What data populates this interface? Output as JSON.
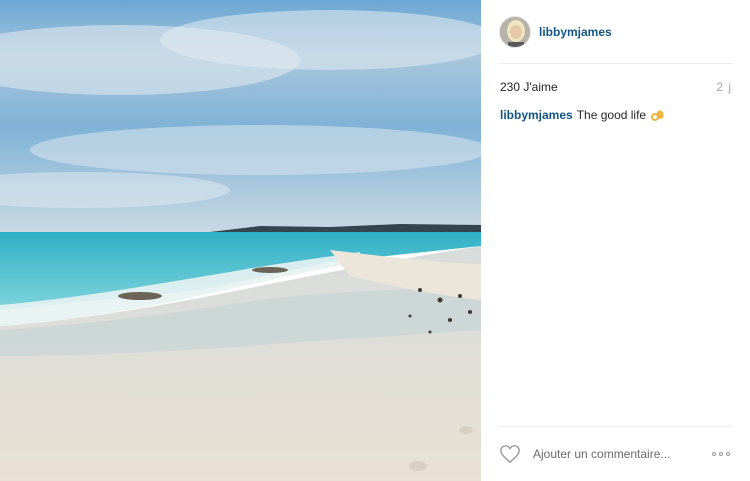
{
  "post": {
    "username": "libbymjames",
    "likes": "230 J'aime",
    "time": "2 j",
    "caption_user": "libbymjames",
    "caption_text": "The good life",
    "caption_emoji": "ok-hand-emoji"
  },
  "comment": {
    "placeholder": "Ajouter un commentaire..."
  },
  "icons": {
    "like": "heart-icon",
    "more": "more-options-icon"
  },
  "colors": {
    "username": "#125688",
    "text": "#262626",
    "time": "#a5a7aa"
  }
}
